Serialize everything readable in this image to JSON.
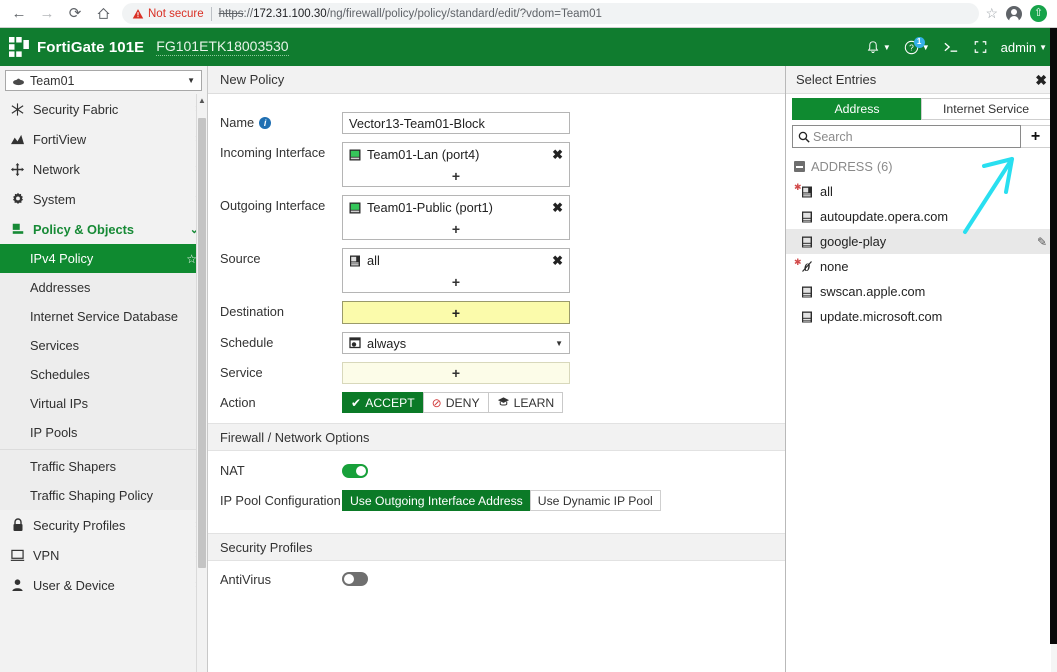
{
  "browser": {
    "back_icon": "back-arrow-icon",
    "forward_icon": "forward-arrow-icon",
    "reload_icon": "reload-icon",
    "home_icon": "home-icon",
    "security_label": "Not secure",
    "url_scheme": "https",
    "url_sep": "://",
    "url_host": "172.31.100.30",
    "url_path": "/ng/firewall/policy/policy/standard/edit/?vdom=Team01",
    "star_icon": "bookmark-star-icon",
    "profile_icon": "profile-avatar-icon",
    "update_icon": "update-available-icon"
  },
  "header": {
    "product": "FortiGate 101E",
    "serial": "FG101ETK18003530",
    "notifications_icon": "bell-icon",
    "help_icon": "help-question-icon",
    "help_badge": "1",
    "cli_icon": "cli-console-icon",
    "fullscreen_icon": "fullscreen-icon",
    "user": "admin",
    "bg_color": "#107c2f"
  },
  "sidebar": {
    "vdom": {
      "label": "Team01",
      "icon": "vdom-icon"
    },
    "items": [
      {
        "label": "Security Fabric",
        "icon": "security-fabric-icon",
        "chevron": "right",
        "type": "parent"
      },
      {
        "label": "FortiView",
        "icon": "fortiview-icon",
        "chevron": "right",
        "type": "parent"
      },
      {
        "label": "Network",
        "icon": "network-icon",
        "chevron": "right",
        "type": "parent"
      },
      {
        "label": "System",
        "icon": "gear-icon",
        "chevron": "right",
        "type": "parent"
      },
      {
        "label": "Policy & Objects",
        "icon": "policy-objects-icon",
        "chevron": "down",
        "type": "parent",
        "active": true
      }
    ],
    "sub_items": [
      {
        "label": "IPv4 Policy",
        "selected": true,
        "star": "☆"
      },
      {
        "label": "Addresses"
      },
      {
        "label": "Internet Service Database"
      },
      {
        "label": "Services"
      },
      {
        "label": "Schedules"
      },
      {
        "label": "Virtual IPs"
      },
      {
        "label": "IP Pools"
      },
      {
        "separator": true
      },
      {
        "label": "Traffic Shapers"
      },
      {
        "label": "Traffic Shaping Policy"
      }
    ],
    "items_after": [
      {
        "label": "Security Profiles",
        "icon": "lock-icon",
        "chevron": "right"
      },
      {
        "label": "VPN",
        "icon": "monitor-icon",
        "chevron": "right"
      },
      {
        "label": "User & Device",
        "icon": "user-icon",
        "chevron": "right"
      }
    ]
  },
  "main": {
    "title": "New Policy",
    "fields": {
      "name_label": "Name",
      "name_value": "Vector13-Team01-Block",
      "incoming_label": "Incoming Interface",
      "incoming_value": "Team01-Lan (port4)",
      "outgoing_label": "Outgoing Interface",
      "outgoing_value": "Team01-Public (port1)",
      "source_label": "Source",
      "source_value": "all",
      "destination_label": "Destination",
      "destination_value": "",
      "schedule_label": "Schedule",
      "schedule_value": "always",
      "service_label": "Service",
      "service_value": "",
      "action_label": "Action",
      "add_glyph": "+",
      "remove_glyph": "✖"
    },
    "action_buttons": [
      {
        "label": "ACCEPT",
        "icon": "check-icon",
        "selected": true
      },
      {
        "label": "DENY",
        "icon": "deny-icon",
        "selected": false
      },
      {
        "label": "LEARN",
        "icon": "learn-icon",
        "selected": false
      }
    ],
    "firewall_section": {
      "title": "Firewall / Network Options",
      "nat_label": "NAT",
      "nat_on": true,
      "ippool_label": "IP Pool Configuration",
      "ippool_options": [
        {
          "label": "Use Outgoing Interface Address",
          "selected": true
        },
        {
          "label": "Use Dynamic IP Pool",
          "selected": false
        }
      ]
    },
    "security_section": {
      "title": "Security Profiles",
      "antivirus_label": "AntiVirus",
      "antivirus_on": false
    }
  },
  "right_panel": {
    "title": "Select Entries",
    "close_icon": "close-icon",
    "tabs": [
      {
        "label": "Address",
        "selected": true
      },
      {
        "label": "Internet Service",
        "selected": false
      }
    ],
    "search": {
      "placeholder": "Search",
      "value": "",
      "icon": "search-icon"
    },
    "add_button": {
      "label": "+",
      "icon": "plus-icon"
    },
    "group": {
      "label": "ADDRESS",
      "count": "(6)"
    },
    "entries": [
      {
        "label": "all",
        "icon": "address-all-icon",
        "required": true,
        "highlighted": false,
        "editable": false
      },
      {
        "label": "autoupdate.opera.com",
        "icon": "address-fqdn-icon",
        "required": false,
        "highlighted": false,
        "editable": false
      },
      {
        "label": "google-play",
        "icon": "address-fqdn-icon",
        "required": false,
        "highlighted": true,
        "editable": true
      },
      {
        "label": "none",
        "icon": "address-none-icon",
        "required": true,
        "highlighted": false,
        "editable": false
      },
      {
        "label": "swscan.apple.com",
        "icon": "address-fqdn-icon",
        "required": false,
        "highlighted": false,
        "editable": false
      },
      {
        "label": "update.microsoft.com",
        "icon": "address-fqdn-icon",
        "required": false,
        "highlighted": false,
        "editable": false
      }
    ],
    "annotation": {
      "type": "arrow",
      "color": "#29dff0",
      "points_to": "add-entry-button"
    }
  }
}
